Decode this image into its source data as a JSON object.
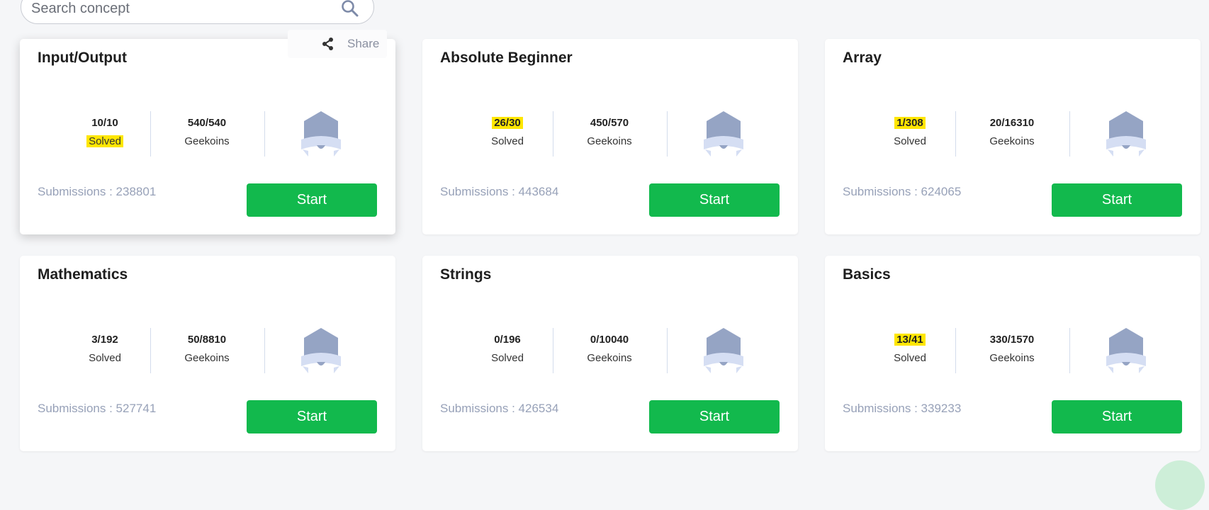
{
  "search": {
    "placeholder": "Search concept",
    "icon": "search-icon"
  },
  "share": {
    "label": "Share",
    "icon": "share-icon"
  },
  "colors": {
    "start_button": "#12b94d",
    "highlight": "#ffe600",
    "badge": "#95a4c4"
  },
  "cards": [
    {
      "title": "Input/Output",
      "solved": "10/10",
      "solved_label": "Solved",
      "geekoins": "540/540",
      "geekoins_label": "Geekoins",
      "submissions": "Submissions : 238801",
      "start": "Start",
      "highlighted": "label"
    },
    {
      "title": "Absolute Beginner",
      "solved": "26/30",
      "solved_label": "Solved",
      "geekoins": "450/570",
      "geekoins_label": "Geekoins",
      "submissions": "Submissions : 443684",
      "start": "Start",
      "highlighted": "value"
    },
    {
      "title": "Array",
      "solved": "1/308",
      "solved_label": "Solved",
      "geekoins": "20/16310",
      "geekoins_label": "Geekoins",
      "submissions": "Submissions : 624065",
      "start": "Start",
      "highlighted": "value"
    },
    {
      "title": "Mathematics",
      "solved": "3/192",
      "solved_label": "Solved",
      "geekoins": "50/8810",
      "geekoins_label": "Geekoins",
      "submissions": "Submissions : 527741",
      "start": "Start",
      "highlighted": "none"
    },
    {
      "title": "Strings",
      "solved": "0/196",
      "solved_label": "Solved",
      "geekoins": "0/10040",
      "geekoins_label": "Geekoins",
      "submissions": "Submissions : 426534",
      "start": "Start",
      "highlighted": "none"
    },
    {
      "title": "Basics",
      "solved": "13/41",
      "solved_label": "Solved",
      "geekoins": "330/1570",
      "geekoins_label": "Geekoins",
      "submissions": "Submissions : 339233",
      "start": "Start",
      "highlighted": "value"
    }
  ]
}
